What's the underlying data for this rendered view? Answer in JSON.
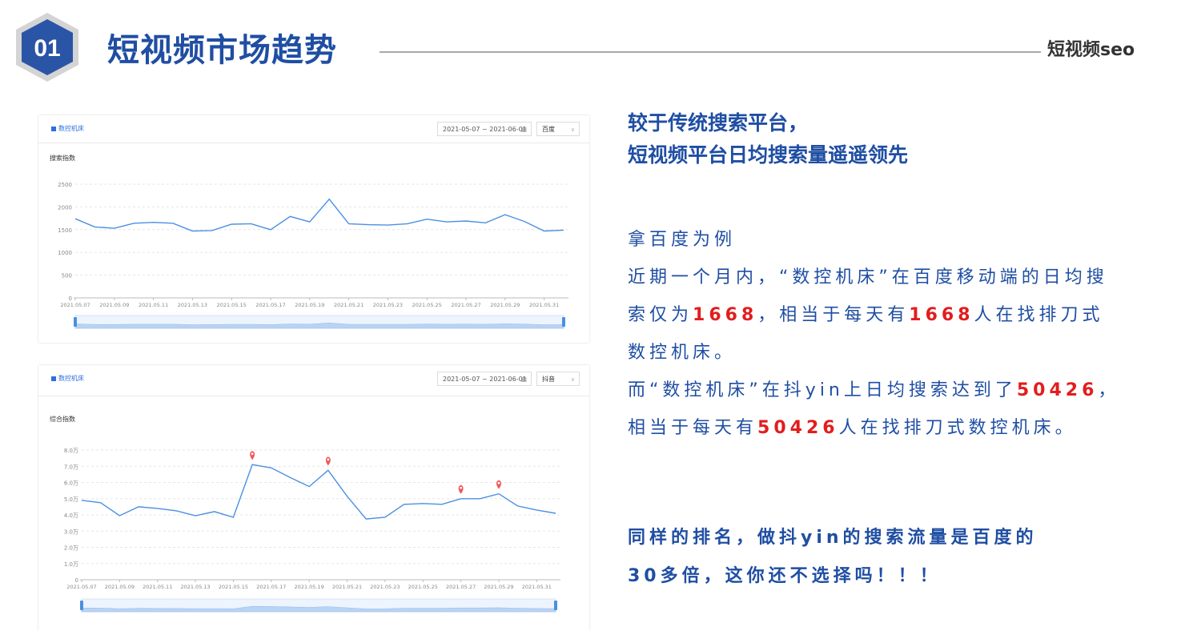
{
  "header": {
    "number": "01",
    "title": "短视频市场趋势",
    "brand": "短视频seo"
  },
  "panel_baidu": {
    "keyword": "数控机床",
    "date_range": "2021-05-07 ~ 2021-06-01",
    "platform": "百度",
    "y_title": "搜索指数",
    "calendar_icon": "calendar-icon",
    "dropdown_icon": "chevron-down-icon"
  },
  "panel_douyin": {
    "keyword": "数控机床",
    "date_range": "2021-05-07 ~ 2021-06-01",
    "platform": "抖音",
    "y_title": "综合指数",
    "calendar_icon": "calendar-icon",
    "dropdown_icon": "chevron-down-icon",
    "marker_icon": "map-pin-icon"
  },
  "chart_data": [
    {
      "type": "line",
      "ylabel": "搜索指数",
      "ylim": [
        0,
        2500
      ],
      "y_ticks": [
        "0",
        "500",
        "1000",
        "1500",
        "2000",
        "2500"
      ],
      "x_ticks": [
        "2021.05.07",
        "2021.05.09",
        "2021.05.11",
        "2021.05.13",
        "2021.05.15",
        "2021.05.17",
        "2021.05.19",
        "2021.05.21",
        "2021.05.23",
        "2021.05.25",
        "2021.05.27",
        "2021.05.29",
        "2021.05.31"
      ],
      "grid": true,
      "color": "#4a90e2",
      "values": [
        1740,
        1560,
        1530,
        1640,
        1660,
        1640,
        1470,
        1480,
        1620,
        1630,
        1500,
        1790,
        1670,
        2170,
        1630,
        1610,
        1600,
        1630,
        1730,
        1670,
        1690,
        1650,
        1830,
        1680,
        1470,
        1490
      ]
    },
    {
      "type": "line",
      "ylabel": "综合指数",
      "ylim": [
        0,
        80000
      ],
      "y_ticks": [
        "0",
        "1.0万",
        "2.0万",
        "3.0万",
        "4.0万",
        "5.0万",
        "6.0万",
        "7.0万",
        "8.0万"
      ],
      "x_ticks": [
        "2021.05.07",
        "2021.05.09",
        "2021.05.11",
        "2021.05.13",
        "2021.05.15",
        "2021.05.17",
        "2021.05.19",
        "2021.05.21",
        "2021.05.23",
        "2021.05.25",
        "2021.05.27",
        "2021.05.29",
        "2021.05.31"
      ],
      "grid": true,
      "color": "#4a90e2",
      "values": [
        49000,
        47500,
        39500,
        45000,
        44000,
        42500,
        39500,
        42000,
        38500,
        71000,
        69000,
        63000,
        57500,
        67500,
        51500,
        37500,
        38500,
        46500,
        47000,
        46500,
        50000,
        50000,
        53000,
        45500,
        43000,
        41000
      ],
      "marker_points": [
        9,
        13,
        20,
        22
      ],
      "marker_color": "#f05a5a"
    }
  ],
  "right": {
    "headline1": "较于传统搜索平台，",
    "headline2": "短视频平台日均搜索量遥遥领先",
    "p1_line1": "拿百度为例",
    "p1_a": "近期一个月内，“数控机床”在百度移动端的日均搜索仅为",
    "num_baidu": "1668",
    "p1_b": "，相当于每天有",
    "num_baidu2": "1668",
    "p1_c": "人在找排刀式数控机床。",
    "p2_a": "而“数控机床”在抖yin上日均搜索达到了",
    "num_douyin": "50426",
    "p2_b": "，相当于每天有",
    "num_douyin2": "50426",
    "p2_c": "人在找排刀式数控机床。",
    "conclusion1": "同样的排名，做抖yin的搜索流量是百度的",
    "conclusion2": "30多倍，这你还不选择吗！！！"
  }
}
